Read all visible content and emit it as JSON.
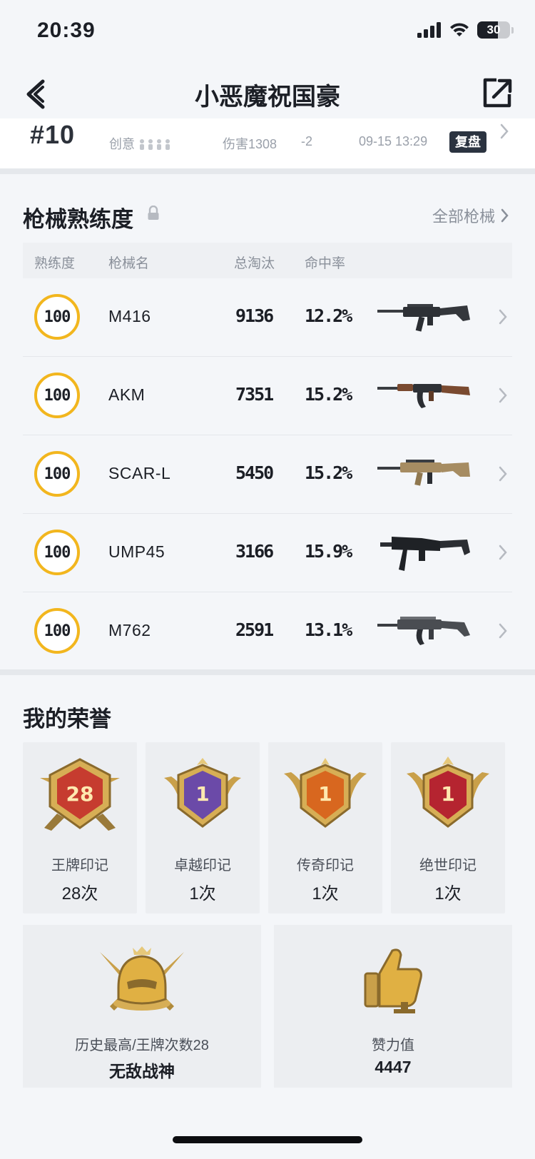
{
  "status_bar": {
    "time": "20:39",
    "battery": "30"
  },
  "nav": {
    "title": "小恶魔祝国豪"
  },
  "match": {
    "rank": "#10",
    "mode": "创意",
    "damage": "伤害1308",
    "change": "-2",
    "time": "09-15 13:29",
    "replay": "复盘"
  },
  "weapons": {
    "title": "枪械熟练度",
    "all_link": "全部枪械",
    "headers": {
      "mastery": "熟练度",
      "name": "枪械名",
      "kills": "总淘汰",
      "hit_rate": "命中率"
    },
    "rows": [
      {
        "mastery": "100",
        "name": "M416",
        "kills": "9136",
        "hit_rate": "12.2%"
      },
      {
        "mastery": "100",
        "name": "AKM",
        "kills": "7351",
        "hit_rate": "15.2%"
      },
      {
        "mastery": "100",
        "name": "SCAR-L",
        "kills": "5450",
        "hit_rate": "15.2%"
      },
      {
        "mastery": "100",
        "name": "UMP45",
        "kills": "3166",
        "hit_rate": "15.9%"
      },
      {
        "mastery": "100",
        "name": "M762",
        "kills": "2591",
        "hit_rate": "13.1%"
      }
    ]
  },
  "honors": {
    "title": "我的荣誉",
    "badges": [
      {
        "name": "王牌印记",
        "count": "28次",
        "number": "28",
        "color": "#c63c2f"
      },
      {
        "name": "卓越印记",
        "count": "1次",
        "number": "1",
        "color": "#6b4aa8"
      },
      {
        "name": "传奇印记",
        "count": "1次",
        "number": "1",
        "color": "#d8671f"
      },
      {
        "name": "绝世印记",
        "count": "1次",
        "number": "1",
        "color": "#b52430"
      }
    ],
    "highest": {
      "label": "历史最高/王牌次数28",
      "value": "无敌战神"
    },
    "likes": {
      "label": "赞力值",
      "value": "4447"
    }
  },
  "colors": {
    "accent_ring": "#f2b61e",
    "background": "#f4f6f9",
    "gold": "#e0b043"
  }
}
